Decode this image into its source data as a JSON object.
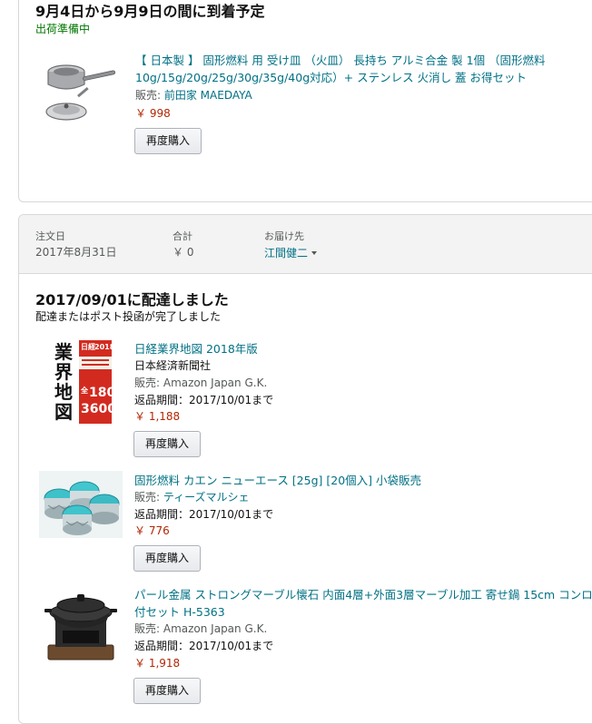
{
  "order1": {
    "arrival_heading": "9月4日から9月9日の間に到着予定",
    "shipping_status": "出荷準備中",
    "item": {
      "title": "【 日本製 】 固形燃料 用 受け皿 （火皿） 長持ち アルミ合金 製 1個 （固形燃料10g/15g/20g/25g/30g/35g/40g対応）+ ステンレス 火消し 蓋 お得セット",
      "seller_label": "販売: ",
      "seller_name": "前田家 MAEDAYA",
      "price": "￥ 998",
      "buy_again": "再度購入",
      "image_icon": "fuel-tray-product-icon"
    }
  },
  "order2": {
    "header": {
      "order_date_label": "注文日",
      "order_date": "2017年8月31日",
      "total_label": "合計",
      "total": "￥ 0",
      "ship_to_label": "お届け先",
      "ship_to": "江間健二"
    },
    "delivered_heading": "2017/09/01に配達しました",
    "delivered_sub": "配達またはポスト投函が完了しました",
    "items": [
      {
        "title": "日経業界地図 2018年版",
        "author": "日本経済新聞社",
        "seller_label": "販売: ",
        "seller_name": "Amazon Japan G.K.",
        "return": "返品期間：2017/10/01まで",
        "price": "￥ 1,188",
        "buy_again": "再度購入",
        "image_icon": "book-cover-icon",
        "cover": {
          "year": "2018",
          "line1": "業",
          "line2": "界",
          "line3": "地",
          "line4": "図",
          "side": "日経",
          "num1": "180",
          "num2": "3600",
          "all": "全"
        }
      },
      {
        "title": "固形燃料 カエン ニューエース [25g] [20個入] 小袋販売",
        "seller_label": "販売: ",
        "seller_name": "ティーズマルシェ",
        "return": "返品期間：2017/10/01まで",
        "price": "￥ 776",
        "buy_again": "再度購入",
        "image_icon": "solid-fuel-cups-icon"
      },
      {
        "title": "パール金属 ストロングマーブル懐石 内面4層+外面3層マーブル加工 寄せ鍋 15cm コンロ付セット H-5363",
        "seller_label": "販売: ",
        "seller_name": "Amazon Japan G.K.",
        "return": "返品期間：2017/10/01まで",
        "price": "￥ 1,918",
        "buy_again": "再度購入",
        "image_icon": "pot-stove-set-icon"
      }
    ]
  },
  "colors": {
    "link": "#007185",
    "price": "#b12704",
    "status_green": "#007600",
    "header_bg": "#f3f3f3"
  }
}
